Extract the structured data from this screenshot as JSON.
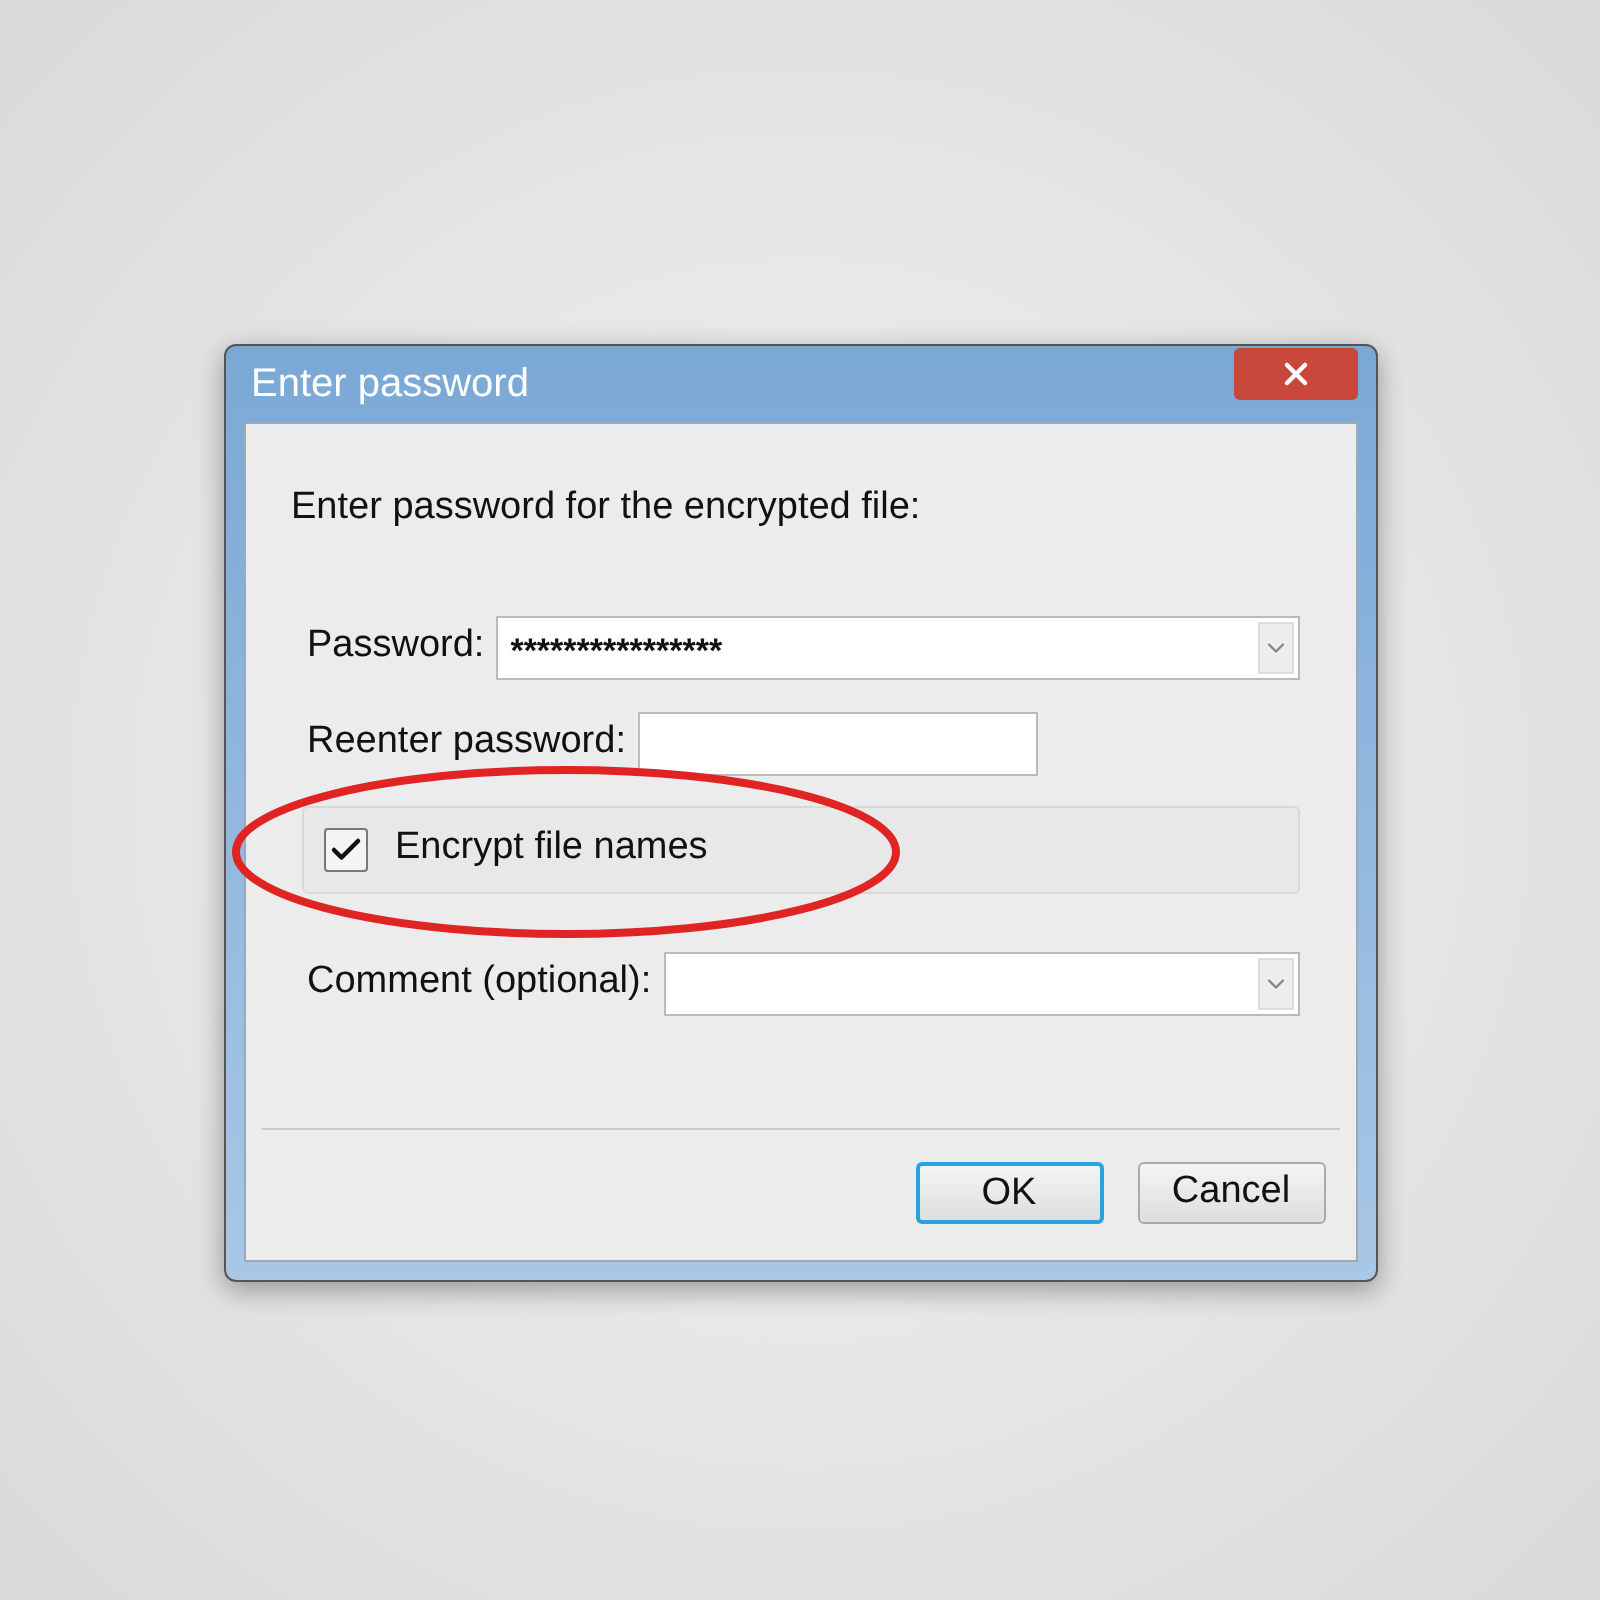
{
  "window": {
    "title": "Enter password"
  },
  "prompt": "Enter password for the encrypted file:",
  "rows": [
    {
      "kind": "dropdown",
      "label": "Password:",
      "value": "****************"
    },
    {
      "kind": "text",
      "label": "Reenter password:"
    },
    {
      "kind": "checkbox",
      "label": "Encrypt file names",
      "checked": true,
      "highlighted": true
    },
    {
      "kind": "dropdown",
      "label": "Comment (optional):"
    }
  ],
  "buttons": [
    {
      "label": "OK",
      "default": true
    },
    {
      "label": "Cancel",
      "default": false
    }
  ]
}
